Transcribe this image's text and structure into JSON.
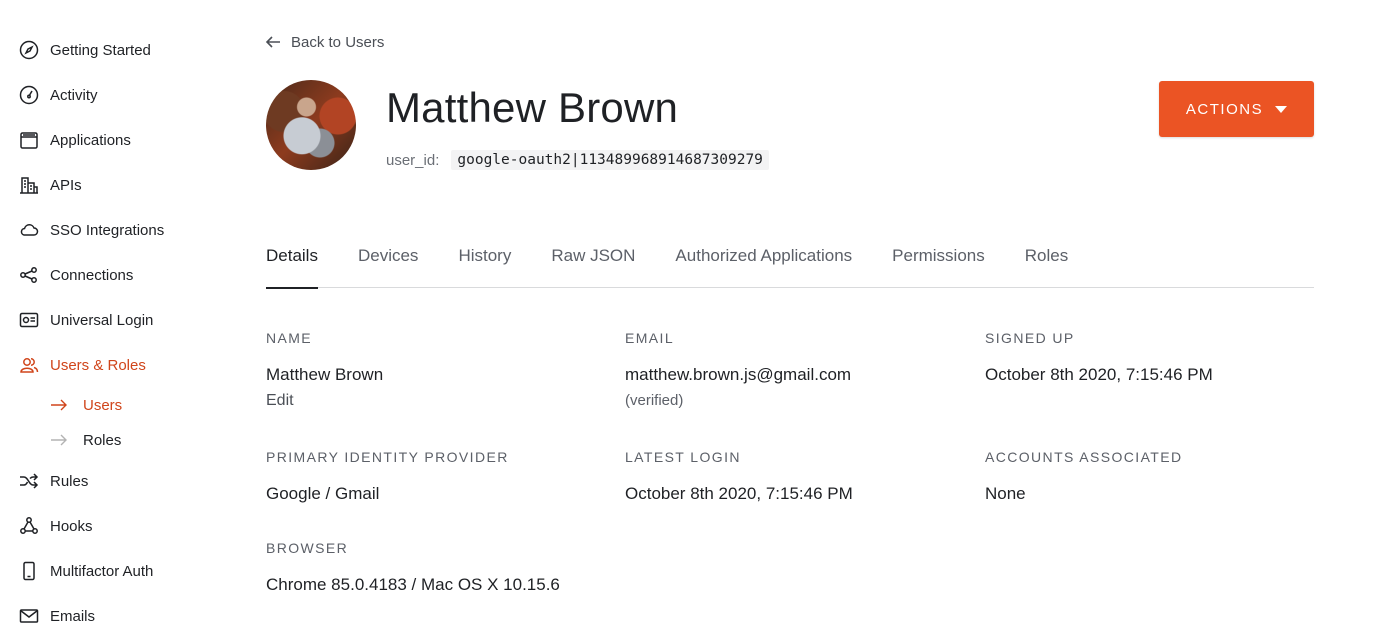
{
  "sidebar": {
    "items": [
      {
        "label": "Getting Started",
        "icon": "compass-icon"
      },
      {
        "label": "Activity",
        "icon": "gauge-icon"
      },
      {
        "label": "Applications",
        "icon": "window-stack-icon"
      },
      {
        "label": "APIs",
        "icon": "buildings-icon"
      },
      {
        "label": "SSO Integrations",
        "icon": "cloud-icon"
      },
      {
        "label": "Connections",
        "icon": "share-nodes-icon"
      },
      {
        "label": "Universal Login",
        "icon": "login-card-icon"
      },
      {
        "label": "Users & Roles",
        "icon": "users-icon"
      },
      {
        "label": "Rules",
        "icon": "shuffle-icon"
      },
      {
        "label": "Hooks",
        "icon": "hooks-icon"
      },
      {
        "label": "Multifactor Auth",
        "icon": "phone-icon"
      },
      {
        "label": "Emails",
        "icon": "envelope-icon"
      }
    ],
    "subitems": [
      {
        "label": "Users"
      },
      {
        "label": "Roles"
      }
    ],
    "active_color": "#d0451b"
  },
  "main": {
    "back_label": "Back to Users",
    "user_name": "Matthew Brown",
    "user_id_label": "user_id:",
    "user_id_value": "google-oauth2|113489968914687309279",
    "actions_label": "ACTIONS",
    "actions_color": "#eb5424",
    "tabs": [
      {
        "label": "Details"
      },
      {
        "label": "Devices"
      },
      {
        "label": "History"
      },
      {
        "label": "Raw JSON"
      },
      {
        "label": "Authorized Applications"
      },
      {
        "label": "Permissions"
      },
      {
        "label": "Roles"
      }
    ],
    "details": {
      "name": {
        "label": "NAME",
        "value": "Matthew Brown",
        "edit": "Edit"
      },
      "email": {
        "label": "EMAIL",
        "value": "matthew.brown.js@gmail.com",
        "note": "(verified)"
      },
      "signed_up": {
        "label": "SIGNED UP",
        "value": "October 8th 2020, 7:15:46 PM"
      },
      "primary_idp": {
        "label": "PRIMARY IDENTITY PROVIDER",
        "value": "Google / Gmail"
      },
      "latest_login": {
        "label": "LATEST LOGIN",
        "value": "October 8th 2020, 7:15:46 PM"
      },
      "accounts_associated": {
        "label": "ACCOUNTS ASSOCIATED",
        "value": "None"
      },
      "browser": {
        "label": "BROWSER",
        "value": "Chrome 85.0.4183 / Mac OS X 10.15.6"
      }
    }
  }
}
